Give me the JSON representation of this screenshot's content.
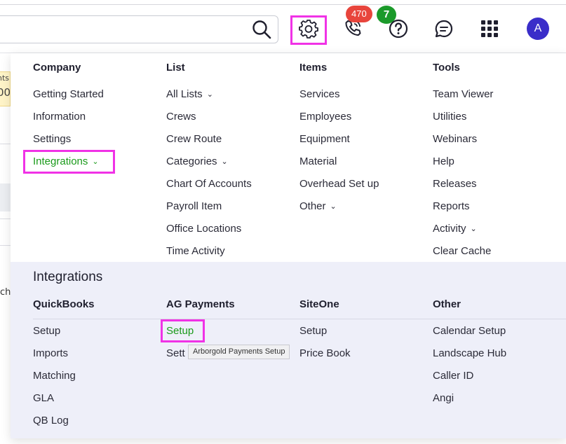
{
  "colors": {
    "accent": "#3a2dc9",
    "highlight": "#f032e6",
    "active_green": "#1a9a1a",
    "badge_red": "#e8453c",
    "badge_green": "#1b9a2a"
  },
  "header": {
    "phone_badge": "470",
    "help_badge": "7",
    "avatar_initial": "A",
    "icons": [
      "search-icon",
      "gear-icon",
      "phone-icon",
      "help-icon",
      "chat-icon",
      "apps-grid-icon"
    ]
  },
  "peek": {
    "yellow_top": "nts",
    "yellow_bottom": "00",
    "side_text": "chi"
  },
  "menu": {
    "columns": [
      {
        "heading": "Company",
        "items": [
          "Getting Started",
          "Information",
          "Settings",
          "Integrations"
        ]
      },
      {
        "heading": "List",
        "items": [
          "All Lists",
          "Crews",
          "Crew Route",
          "Categories",
          "Chart Of Accounts",
          "Payroll Item",
          "Office Locations",
          "Time Activity"
        ]
      },
      {
        "heading": "Items",
        "items": [
          "Services",
          "Employees",
          "Equipment",
          "Material",
          "Overhead Set up",
          "Other"
        ]
      },
      {
        "heading": "Tools",
        "items": [
          "Team Viewer",
          "Utilities",
          "Webinars",
          "Help",
          "Releases",
          "Reports",
          "Activity",
          "Clear Cache"
        ]
      }
    ]
  },
  "integrations": {
    "title": "Integrations",
    "columns": [
      {
        "heading": "QuickBooks",
        "items": [
          "Setup",
          "Imports",
          "Matching",
          "GLA",
          "QB Log"
        ]
      },
      {
        "heading": "AG Payments",
        "items": [
          "Setup",
          "Sett"
        ]
      },
      {
        "heading": "SiteOne",
        "items": [
          "Setup",
          "Price Book"
        ]
      },
      {
        "heading": "Other",
        "items": [
          "Calendar Setup",
          "Landscape Hub",
          "Caller ID",
          "Angi"
        ]
      }
    ],
    "tooltip": "Arborgold Payments Setup"
  }
}
